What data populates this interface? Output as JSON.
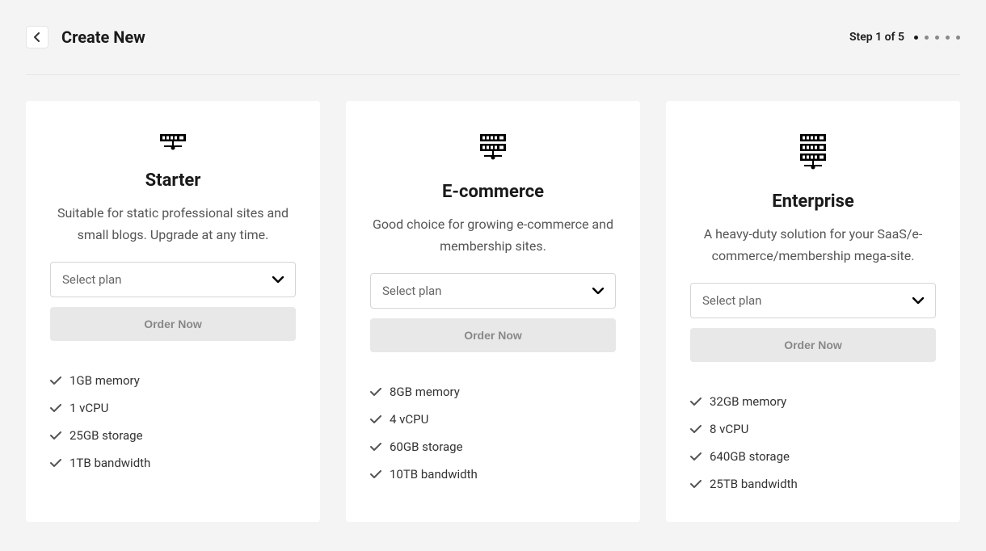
{
  "header": {
    "title": "Create New",
    "step_text": "Step 1 of 5"
  },
  "plans": [
    {
      "id": "starter",
      "title": "Starter",
      "description": "Suitable for static professional sites and small blogs. Upgrade at any time.",
      "select_label": "Select plan",
      "order_label": "Order Now",
      "features": [
        "1GB memory",
        "1 vCPU",
        "25GB storage",
        "1TB bandwidth"
      ]
    },
    {
      "id": "ecommerce",
      "title": "E-commerce",
      "description": "Good choice for growing e-commerce and membership sites.",
      "select_label": "Select plan",
      "order_label": "Order Now",
      "features": [
        "8GB memory",
        "4 vCPU",
        "60GB storage",
        "10TB bandwidth"
      ]
    },
    {
      "id": "enterprise",
      "title": "Enterprise",
      "description": "A heavy-duty solution for your SaaS/e-commerce/membership mega-site.",
      "select_label": "Select plan",
      "order_label": "Order Now",
      "features": [
        "32GB memory",
        "8 vCPU",
        "640GB storage",
        "25TB bandwidth"
      ]
    }
  ]
}
